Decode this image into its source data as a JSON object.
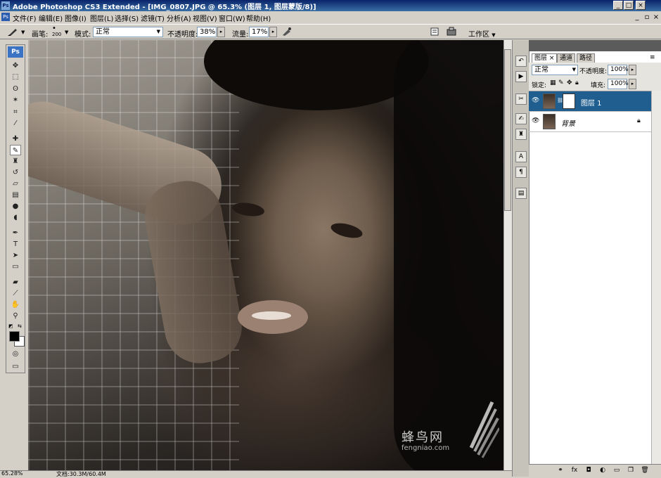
{
  "window": {
    "title": "Adobe Photoshop CS3 Extended - [IMG_0807.JPG @ 65.3% (图层 1, 图层蒙版/8)]",
    "app_badge": "Ps",
    "buttons": {
      "minimize": "_",
      "maximize": "□",
      "close": "×"
    }
  },
  "menu": {
    "items": [
      "文件(F)",
      "编辑(E)",
      "图像(I)",
      "图层(L)",
      "选择(S)",
      "滤镜(T)",
      "分析(A)",
      "视图(V)",
      "窗口(W)",
      "帮助(H)"
    ],
    "doc_buttons": {
      "minimize": "_",
      "restore": "▫",
      "close": "×"
    }
  },
  "options": {
    "brush_label": "画笔:",
    "brush_size": "200",
    "mode_label": "模式:",
    "mode_value": "正常",
    "opacity_label": "不透明度:",
    "opacity_value": "38%",
    "flow_label": "流量:",
    "flow_value": "17%",
    "workspace_label": "工作区"
  },
  "toolbox": {
    "logo": "Ps",
    "tools": [
      "move-tool",
      "marquee-tool",
      "lasso-tool",
      "magic-wand-tool",
      "crop-tool",
      "slice-tool",
      "healing-brush-tool",
      "brush-tool",
      "clone-stamp-tool",
      "history-brush-tool",
      "eraser-tool",
      "gradient-tool",
      "blur-tool",
      "dodge-tool",
      "pen-tool",
      "type-tool",
      "path-selection-tool",
      "shape-tool",
      "notes-tool",
      "eyedropper-tool",
      "hand-tool",
      "zoom-tool"
    ],
    "active_tool": "brush-tool",
    "foreground_color": "#000000",
    "background_color": "#ffffff"
  },
  "canvas": {
    "watermark_cn": "蜂鸟网",
    "watermark_url": "fengniao.com"
  },
  "status": {
    "zoom": "65.28%",
    "doc_size": "文档:30.3M/60.4M"
  },
  "layers_panel": {
    "tabs": [
      "图层",
      "通道",
      "路径"
    ],
    "active_tab": "图层",
    "blend_mode": "正常",
    "opacity_label": "不透明度:",
    "opacity_value": "100%",
    "lock_label": "锁定:",
    "fill_label": "填充:",
    "fill_value": "100%",
    "layers": [
      {
        "name": "图层 1",
        "selected": true,
        "has_mask": true
      },
      {
        "name": "背景",
        "selected": false,
        "locked": true
      }
    ]
  },
  "colors": {
    "selected_layer": "#1f5e8f",
    "titlebar": "#0a246a",
    "chrome": "#d4d0c8"
  }
}
